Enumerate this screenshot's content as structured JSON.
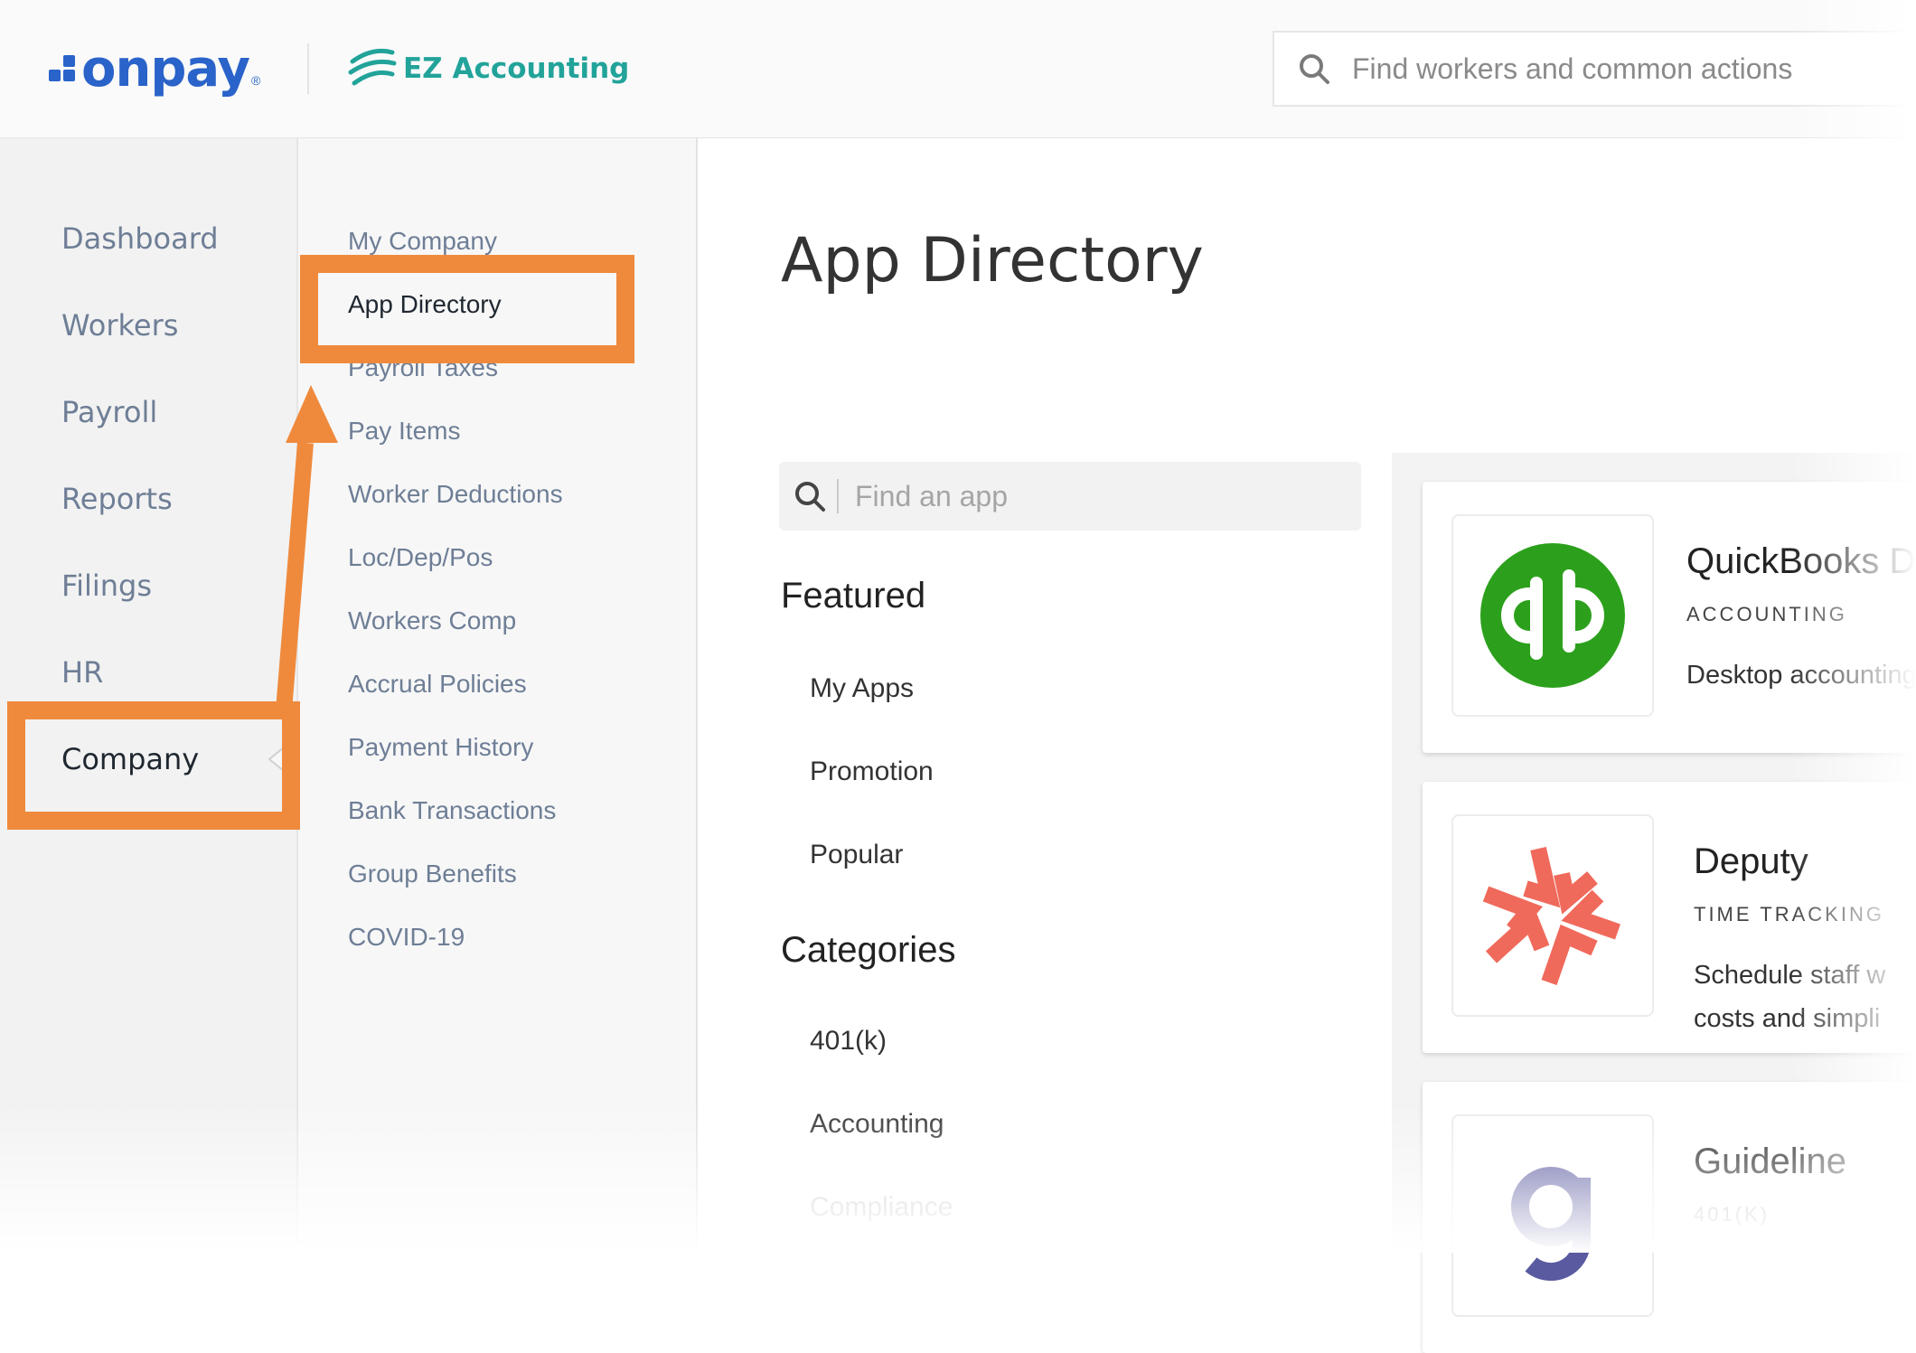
{
  "header": {
    "brand": "onpay",
    "brand_mark": "®",
    "partner": "EZ Accounting",
    "search_placeholder": "Find workers and common actions"
  },
  "primary_nav": {
    "items": [
      {
        "label": "Dashboard"
      },
      {
        "label": "Workers"
      },
      {
        "label": "Payroll"
      },
      {
        "label": "Reports"
      },
      {
        "label": "Filings"
      },
      {
        "label": "HR"
      },
      {
        "label": "Company",
        "active": true
      }
    ]
  },
  "secondary_nav": {
    "items": [
      {
        "label": "My Company"
      },
      {
        "label": "App Directory",
        "active": true
      },
      {
        "label": "Payroll Taxes"
      },
      {
        "label": "Pay Items"
      },
      {
        "label": "Worker Deductions"
      },
      {
        "label": "Loc/Dep/Pos"
      },
      {
        "label": "Workers Comp"
      },
      {
        "label": "Accrual Policies"
      },
      {
        "label": "Payment History"
      },
      {
        "label": "Bank Transactions"
      },
      {
        "label": "Group Benefits"
      },
      {
        "label": "COVID-19"
      }
    ]
  },
  "main": {
    "title": "App Directory",
    "app_search_placeholder": "Find an app",
    "featured": {
      "heading": "Featured",
      "items": [
        "My Apps",
        "Promotion",
        "Popular"
      ]
    },
    "categories": {
      "heading": "Categories",
      "items": [
        "401(k)",
        "Accounting",
        "Compliance"
      ]
    },
    "apps": [
      {
        "name": "QuickBooks D",
        "category": "ACCOUNTING",
        "description": "Desktop accounting"
      },
      {
        "name": "Deputy",
        "category": "TIME TRACKING",
        "description": "Schedule staff w costs and simpli"
      },
      {
        "name": "Guideline",
        "category": "401(K)",
        "description": ""
      }
    ]
  },
  "colors": {
    "brand_blue": "#2a63c9",
    "ez_teal": "#22a39a",
    "highlight_orange": "#ef8a3d",
    "quickbooks_green": "#2ca01c",
    "deputy_coral": "#f06a5c"
  }
}
